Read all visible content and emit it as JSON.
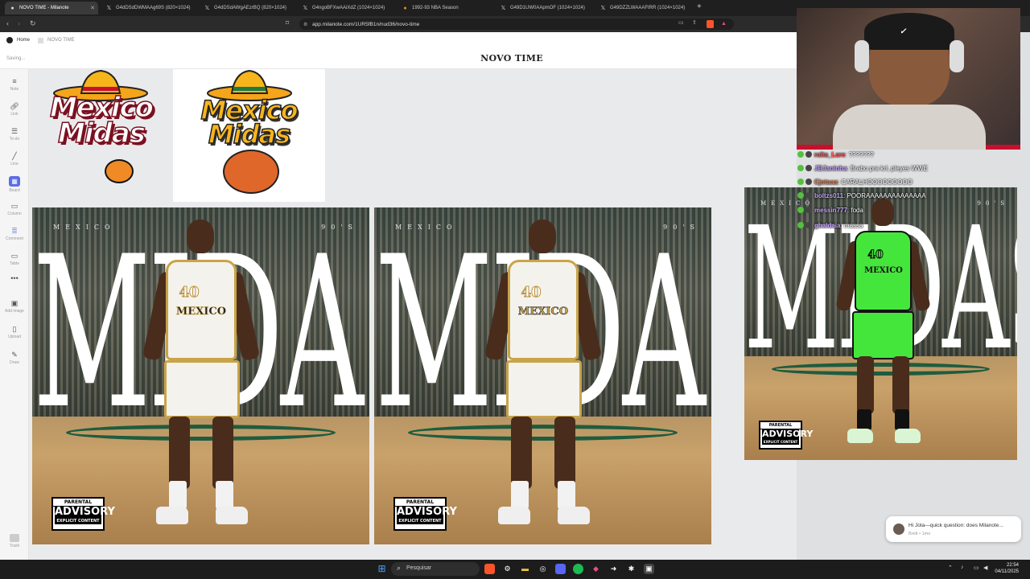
{
  "browser": {
    "tabs": [
      {
        "label": "NOVO TIME - Milanote",
        "icon": "milanote-icon",
        "active": true
      },
      {
        "label": "G4dDSdDWMAAg69S (820×1024)",
        "icon": "x-logo-icon"
      },
      {
        "label": "G4dDSdAWgAEzrBQ (820×1024)",
        "icon": "x-logo-icon"
      },
      {
        "label": "G4ngoBFXwAAiXdZ (1024×1024)",
        "icon": "x-logo-icon"
      },
      {
        "label": "1992-93 NBA Season",
        "icon": "basketball-icon"
      },
      {
        "label": "G49D1UW0AApmOF (1024×1024)",
        "icon": "x-logo-icon"
      },
      {
        "label": "G49DZZLWAAAFtRR (1024×1024)",
        "icon": "x-logo-icon"
      }
    ],
    "url": "app.milanote.com/1UR5fB1n/nud36/novo-time"
  },
  "milanote": {
    "breadcrumb_home": "Home",
    "breadcrumb_board": "NOVO TIME",
    "board_title": "NOVO TIME",
    "save_status": "Saving...",
    "tools": [
      {
        "label": "Note",
        "icon": "note-icon"
      },
      {
        "label": "Link",
        "icon": "link-icon"
      },
      {
        "label": "To-do",
        "icon": "todo-icon"
      },
      {
        "label": "Line",
        "icon": "line-icon"
      },
      {
        "label": "Board",
        "icon": "board-icon"
      },
      {
        "label": "Column",
        "icon": "column-icon"
      },
      {
        "label": "Comment",
        "icon": "comment-icon"
      },
      {
        "label": "Table",
        "icon": "table-icon"
      },
      {
        "label": "",
        "icon": "more-icon"
      },
      {
        "label": "Add image",
        "icon": "add-image-icon"
      },
      {
        "label": "Upload",
        "icon": "upload-icon"
      },
      {
        "label": "Draw",
        "icon": "draw-icon"
      }
    ],
    "trash_label": "Trash"
  },
  "logos": {
    "line1": "Mexico",
    "line2": "Midas"
  },
  "posters": {
    "top_left": "MEXICO",
    "top_right": "90'S",
    "big_word": "MIDAS",
    "jersey_number": "40",
    "jersey_name": "MEXICO",
    "advisory_line1": "PARENTAL",
    "advisory_line2": "ADVISORY",
    "advisory_line3": "EXPLICIT CONTENT"
  },
  "stream_chat": [
    {
      "user": "ralta_Lare",
      "msg": "???????"
    },
    {
      "user": "JBJaninha",
      "msg": "Brabo pra krl, pleyes WWE"
    },
    {
      "user": "Cjotaaa",
      "msg": "CARALHOOOOOOOOO"
    },
    {
      "user": "boltzs011",
      "msg": "POORAAAAAAAAAAAAAA"
    },
    {
      "user": "messin777",
      "msg": "foda"
    },
    {
      "user": "gbaldaia",
      "msg": "massa"
    }
  ],
  "notification": {
    "message": "Hi Jota—quick question: does Milanote...",
    "meta": "Brett • 1mo"
  },
  "taskbar": {
    "search_placeholder": "Pesquisar",
    "time": "22:54",
    "date": "04/11/2025"
  },
  "colors": {
    "logo_gold": "#f7b51c",
    "logo_maroon": "#7a1020",
    "green_kit": "#45e63b",
    "stream_red": "#c8102e"
  }
}
